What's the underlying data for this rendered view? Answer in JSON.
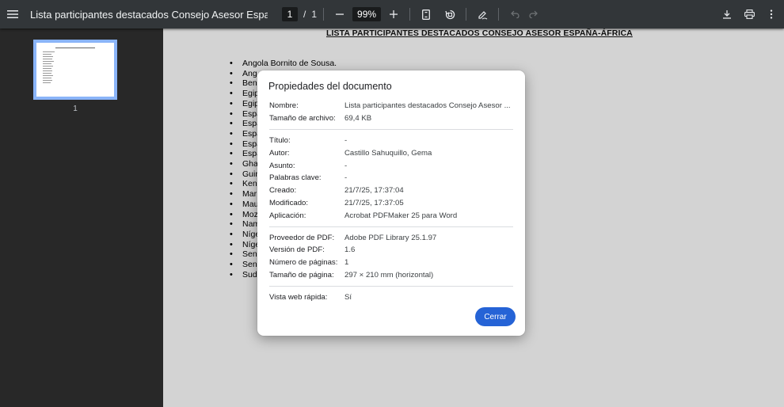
{
  "toolbar": {
    "title": "Lista participantes destacados Consejo Asesor España-África ...",
    "page_current": "1",
    "page_separator": "/",
    "page_total": "1",
    "zoom": "99%"
  },
  "sidebar": {
    "thumbnail_number": "1"
  },
  "page": {
    "heading": "LISTA PARTICIPANTES DESTACADOS CONSEJO ASESOR ESPAÑA-ÁFRICA",
    "items": [
      "Angola Bornito de Sousa.",
      "Ang",
      "Ben",
      "Egip",
      "Egip",
      "Espa",
      "Espa",
      "Espa",
      "Espa",
      "Espa",
      "Gha",
      "Guin",
      "Ken",
      "Mar",
      "Mau",
      "Moz",
      "Nam",
      "Níge",
      "Níge",
      "Sen",
      "Sen",
      "Sud"
    ]
  },
  "dialog": {
    "title": "Propiedades del documento",
    "group1": [
      {
        "label": "Nombre:",
        "value": "Lista participantes destacados Consejo Asesor ..."
      },
      {
        "label": "Tamaño de archivo:",
        "value": "69,4 KB"
      }
    ],
    "group2": [
      {
        "label": "Título:",
        "value": "-"
      },
      {
        "label": "Autor:",
        "value": "Castillo Sahuquillo, Gema"
      },
      {
        "label": "Asunto:",
        "value": "-"
      },
      {
        "label": "Palabras clave:",
        "value": "-"
      },
      {
        "label": "Creado:",
        "value": "21/7/25, 17:37:04"
      },
      {
        "label": "Modificado:",
        "value": "21/7/25, 17:37:05"
      },
      {
        "label": "Aplicación:",
        "value": "Acrobat PDFMaker 25 para Word"
      }
    ],
    "group3": [
      {
        "label": "Proveedor de PDF:",
        "value": "Adobe PDF Library 25.1.97"
      },
      {
        "label": "Versión de PDF:",
        "value": "1.6"
      },
      {
        "label": "Número de páginas:",
        "value": "1"
      },
      {
        "label": "Tamaño de página:",
        "value": "297 × 210 mm (horizontal)"
      }
    ],
    "group4": [
      {
        "label": "Vista web rápida:",
        "value": "Sí"
      }
    ],
    "close_label": "Cerrar"
  },
  "colors": {
    "toolbar_bg": "#323639",
    "accent": "#2563d6",
    "thumb_border": "#8ab4f8"
  },
  "icons": [
    "menu-icon",
    "minus-icon",
    "plus-icon",
    "fit-page-icon",
    "rotate-icon",
    "annotate-icon",
    "undo-icon",
    "redo-icon",
    "download-icon",
    "print-icon",
    "more-vert-icon"
  ]
}
